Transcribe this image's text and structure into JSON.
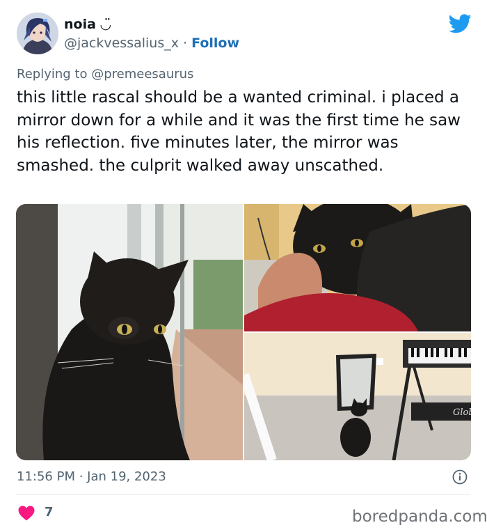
{
  "author": {
    "display_name": "noia ◡̈",
    "handle": "@jackvessalius_x",
    "separator": "·",
    "follow_label": "Follow"
  },
  "reply": {
    "prefix": "Replying to",
    "mention": "@premeesaurus"
  },
  "tweet": {
    "text": "this little rascal should be a wanted criminal. i placed a mirror down for a while and it was the first time he saw his reflection. five minutes later, the mirror was smashed. the culprit walked away unscathed."
  },
  "meta": {
    "timestamp": "11:56 PM · Jan 19, 2023"
  },
  "engagement": {
    "likes": "7"
  },
  "watermark": "boredpanda.com",
  "keyboard_brand": "Glob",
  "colors": {
    "brand_blue": "#1d9bf0",
    "follow_blue": "#1d6fb8",
    "heart_red": "#f91880",
    "secondary_text": "#536471"
  },
  "icons": [
    "twitter-bird-icon",
    "info-icon",
    "heart-icon"
  ]
}
